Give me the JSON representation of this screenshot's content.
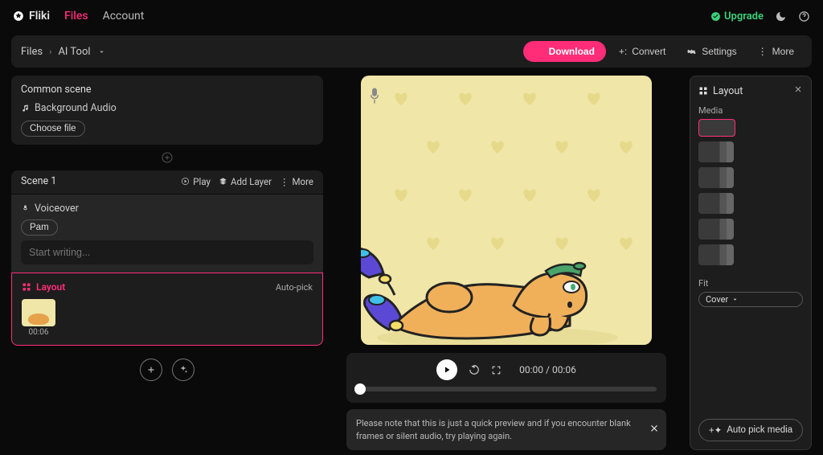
{
  "brand": "Fliki",
  "nav": {
    "files": "Files",
    "account": "Account"
  },
  "upgrade": "Upgrade",
  "breadcrumb": {
    "root": "Files",
    "current": "AI Tool"
  },
  "actions": {
    "download": "Download",
    "convert": "Convert",
    "settings": "Settings",
    "more": "More"
  },
  "common_scene": {
    "title": "Common scene",
    "bg_audio_label": "Background Audio",
    "choose_file": "Choose file"
  },
  "scene": {
    "label": "Scene 1",
    "play": "Play",
    "add_layer": "Add Layer",
    "more": "More",
    "voiceover_label": "Voiceover",
    "voice_name": "Pam",
    "script_placeholder": "Start writing...",
    "layout_label": "Layout",
    "auto_pick": "Auto-pick",
    "thumb_time": "00:06"
  },
  "player": {
    "time": "00:00 / 00:06"
  },
  "notice": "Please note that this is just a quick preview and if you encounter blank frames or silent audio, try playing again.",
  "right": {
    "title": "Layout",
    "media_label": "Media",
    "fit_label": "Fit",
    "fit_value": "Cover",
    "auto_pick_media": "Auto pick media"
  }
}
